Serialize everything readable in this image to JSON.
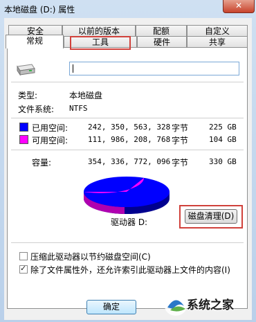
{
  "window": {
    "title": "本地磁盘 (D:) 属性",
    "close_label": "✕"
  },
  "tabs_row1": [
    {
      "label": "安全"
    },
    {
      "label": "以前的版本"
    },
    {
      "label": "配额"
    },
    {
      "label": "自定义"
    }
  ],
  "tabs_row2": [
    {
      "label": "常规",
      "active": true
    },
    {
      "label": "工具",
      "highlighted": true
    },
    {
      "label": "硬件"
    },
    {
      "label": "共享"
    }
  ],
  "general": {
    "volume_name_value": "",
    "type_label": "类型:",
    "type_value": "本地磁盘",
    "fs_label": "文件系统:",
    "fs_value": "NTFS",
    "used": {
      "label": "已用空间:",
      "bytes": "242, 350, 563, 328",
      "unit": "字节",
      "size": "225 GB",
      "color": "#0000ff",
      "value": 225
    },
    "free": {
      "label": "可用空间:",
      "bytes": "111, 986, 208, 768",
      "unit": "字节",
      "size": "104 GB",
      "color": "#ff00ff",
      "value": 104
    },
    "capacity": {
      "label": "容量:",
      "bytes": "354, 336, 772, 096",
      "unit": "字节",
      "size": "330 GB"
    },
    "drive_label": "驱动器 D:",
    "cleanup_button": "磁盘清理(D)",
    "compress_checkbox": {
      "label": "压缩此驱动器以节约磁盘空间(C)",
      "checked": false
    },
    "index_checkbox": {
      "label": "除了文件属性外，还允许索引此驱动器上文件的内容(I)",
      "checked": true
    }
  },
  "footer": {
    "ok_button": "确定"
  },
  "watermark": {
    "text": "系统之家"
  }
}
